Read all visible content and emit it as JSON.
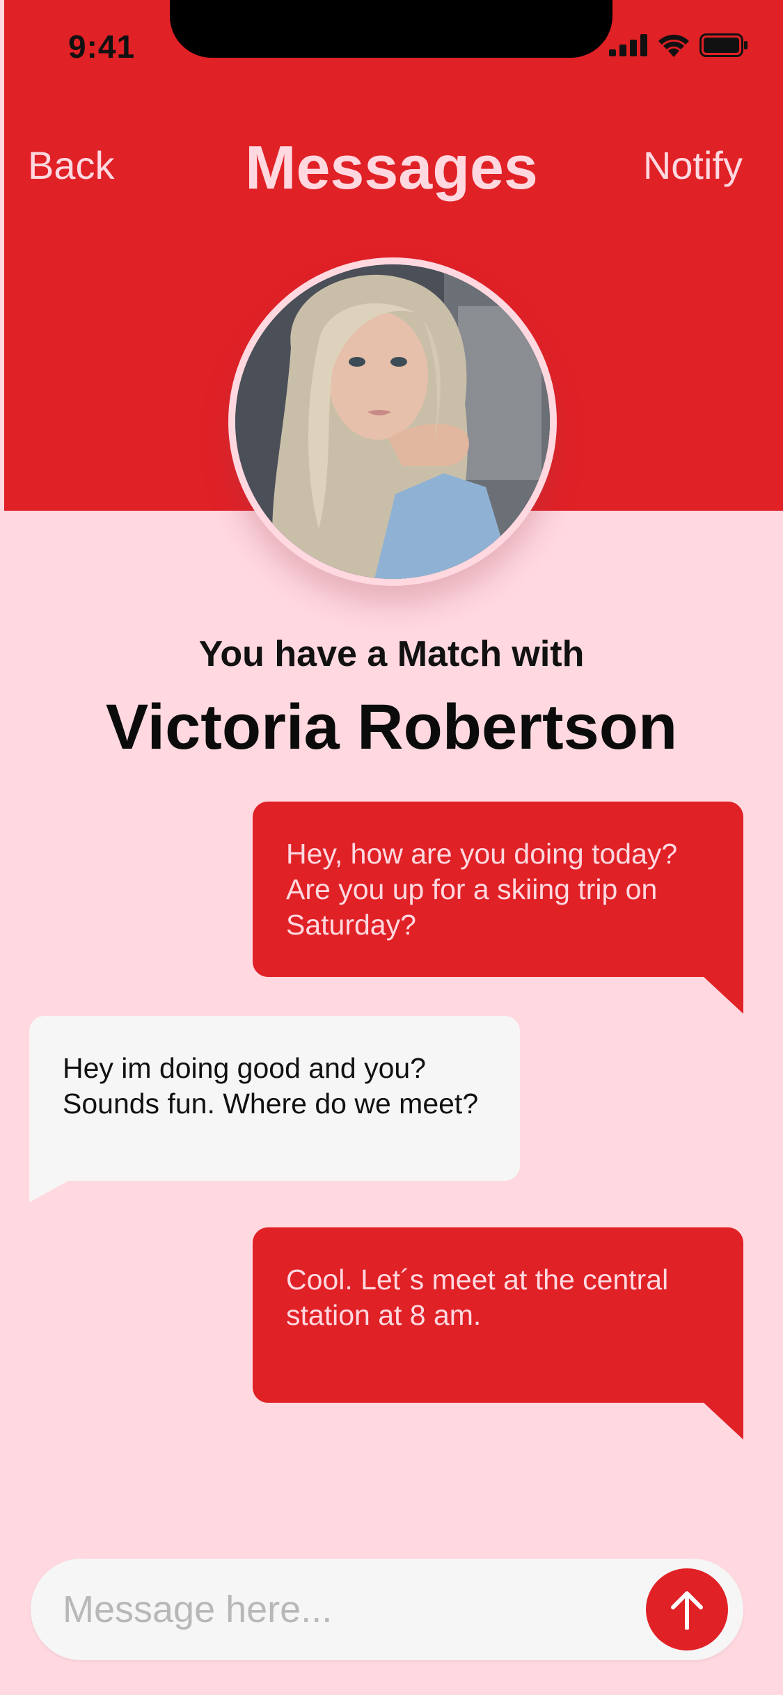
{
  "status_bar": {
    "time": "9:41",
    "icons": [
      "signal-icon",
      "wifi-icon",
      "battery-icon"
    ]
  },
  "nav": {
    "back_label": "Back",
    "title": "Messages",
    "notify_label": "Notify"
  },
  "match": {
    "subtitle": "You have a Match with",
    "name": "Victoria Robertson"
  },
  "messages": [
    {
      "direction": "outgoing",
      "text": "Hey, how are you doing today? Are you up for a skiing trip on Saturday?"
    },
    {
      "direction": "incoming",
      "text": "Hey im doing good and you? Sounds fun. Where do we meet?"
    },
    {
      "direction": "outgoing",
      "text": "Cool. Let´s meet at the central station at 8 am."
    }
  ],
  "composer": {
    "placeholder": "Message here...",
    "value": "",
    "send_icon": "arrow-up-icon"
  },
  "colors": {
    "primary": "#E02126",
    "background": "#FFD8E0",
    "bubble_incoming": "#F6F6F6",
    "text_dark": "#111111"
  }
}
